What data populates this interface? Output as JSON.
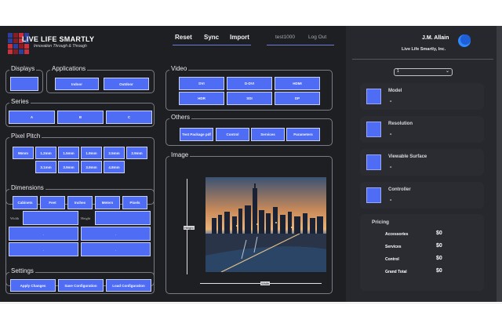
{
  "brand": {
    "name": "LIVE LIFE SMARTLY",
    "tagline": "Innovation Through & Through",
    "colors": [
      "#2a3f9e",
      "#8a1c24",
      "#c9323d",
      "#2a3f9e",
      "#2a3f9e",
      "#8a1c24",
      "#c9323d",
      "#2a3f9e",
      "#c9323d",
      "#2a3f9e",
      "#8a1c24",
      "#c9323d",
      "#c9323d",
      "#8a1c24",
      "#2a3f9e",
      "#c9323d"
    ]
  },
  "nav": {
    "reset": "Reset",
    "sync": "Sync",
    "import": "Import",
    "user": "test1000",
    "logout": "Log Out"
  },
  "profile": {
    "name": "J.M. Allain",
    "company": "Live Life Smartly, Inc.",
    "avatar_icon": "user-avatar-circle",
    "select_value": "1"
  },
  "sections": {
    "displays": "Displays",
    "applications": "Applications",
    "series": "Series",
    "pixel_pitch": "Pixel Pitch",
    "dimensions": "Dimensions",
    "settings": "Settings",
    "video": "Video",
    "others": "Others",
    "image": "Image"
  },
  "applications": [
    "Indoor",
    "Outdoor"
  ],
  "series": [
    "A",
    "B",
    "C"
  ],
  "pixel_pitch": [
    "96mm",
    "1.2mm",
    "1.5mm",
    "1.9mm",
    "2.5mm",
    "2.9mm",
    "3.1mm",
    "3.9mm",
    "3.9mm",
    "4.8mm"
  ],
  "dimensions": {
    "units": [
      "Cabinets",
      "Feet",
      "Inches",
      "Meters",
      "Pixels"
    ],
    "width_label": "Width",
    "height_label": "Height",
    "dash": "-"
  },
  "settings": [
    "Apply Changes",
    "Save Configuration",
    "Load Configuration"
  ],
  "video": [
    "DVI",
    "D-DVI",
    "HDMI",
    "HDR",
    "SDI",
    "DP"
  ],
  "others": [
    "Test Package pdf",
    "Control",
    "Services",
    "Parameters"
  ],
  "image": {
    "height_tag": "Height",
    "width_tag": "Width"
  },
  "cards": [
    {
      "title": "Model",
      "value": "-"
    },
    {
      "title": "Resolution",
      "value": "-"
    },
    {
      "title": "Viewable Surface",
      "value": "-"
    },
    {
      "title": "Controller",
      "value": "-"
    }
  ],
  "pricing": {
    "title": "Pricing",
    "rows": [
      {
        "label": "Accessories",
        "value": "$0"
      },
      {
        "label": "Services",
        "value": "$0"
      },
      {
        "label": "Control",
        "value": "$0"
      },
      {
        "label": "Grand Total",
        "value": "$0"
      }
    ]
  },
  "theme": {
    "background": "#1e1f23",
    "sidebar": "#27282d",
    "accent": "#4f6cf4"
  }
}
